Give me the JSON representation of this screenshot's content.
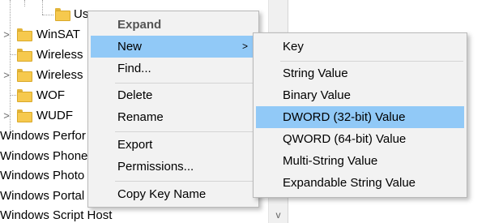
{
  "tree": {
    "rows": [
      {
        "label": "Us",
        "kind": "child"
      },
      {
        "label": "WinSAT",
        "kind": "expandable"
      },
      {
        "label": "Wireless",
        "kind": "leaf"
      },
      {
        "label": "Wireless",
        "kind": "expandable"
      },
      {
        "label": "WOF",
        "kind": "leaf"
      },
      {
        "label": "WUDF",
        "kind": "expandable"
      },
      {
        "label": "Windows Perfor",
        "kind": "root"
      },
      {
        "label": "Windows Phone",
        "kind": "root"
      },
      {
        "label": "Windows Photo",
        "kind": "root"
      },
      {
        "label": "Windows Portal",
        "kind": "root"
      },
      {
        "label": "Windows Script Host",
        "kind": "root"
      }
    ],
    "expander_glyph": ">",
    "scroll_down_glyph": "v"
  },
  "context_menu": {
    "items": [
      {
        "label": "Expand",
        "style": "bold"
      },
      {
        "label": "New",
        "style": "highlight",
        "submenu_arrow": ">"
      },
      {
        "label": "Find...",
        "style": "normal"
      },
      {
        "label": "Delete",
        "style": "normal"
      },
      {
        "label": "Rename",
        "style": "normal"
      },
      {
        "label": "Export",
        "style": "normal"
      },
      {
        "label": "Permissions...",
        "style": "normal"
      },
      {
        "label": "Copy Key Name",
        "style": "normal"
      }
    ]
  },
  "new_submenu": {
    "items": [
      {
        "label": "Key",
        "style": "normal"
      },
      {
        "label": "String Value",
        "style": "normal"
      },
      {
        "label": "Binary Value",
        "style": "normal"
      },
      {
        "label": "DWORD (32-bit) Value",
        "style": "highlight"
      },
      {
        "label": "QWORD (64-bit) Value",
        "style": "normal"
      },
      {
        "label": "Multi-String Value",
        "style": "normal"
      },
      {
        "label": "Expandable String Value",
        "style": "normal"
      }
    ]
  },
  "colors": {
    "highlight": "#91c9f7",
    "menu_background": "#f2f2f2",
    "folder": "#f6c94e"
  }
}
